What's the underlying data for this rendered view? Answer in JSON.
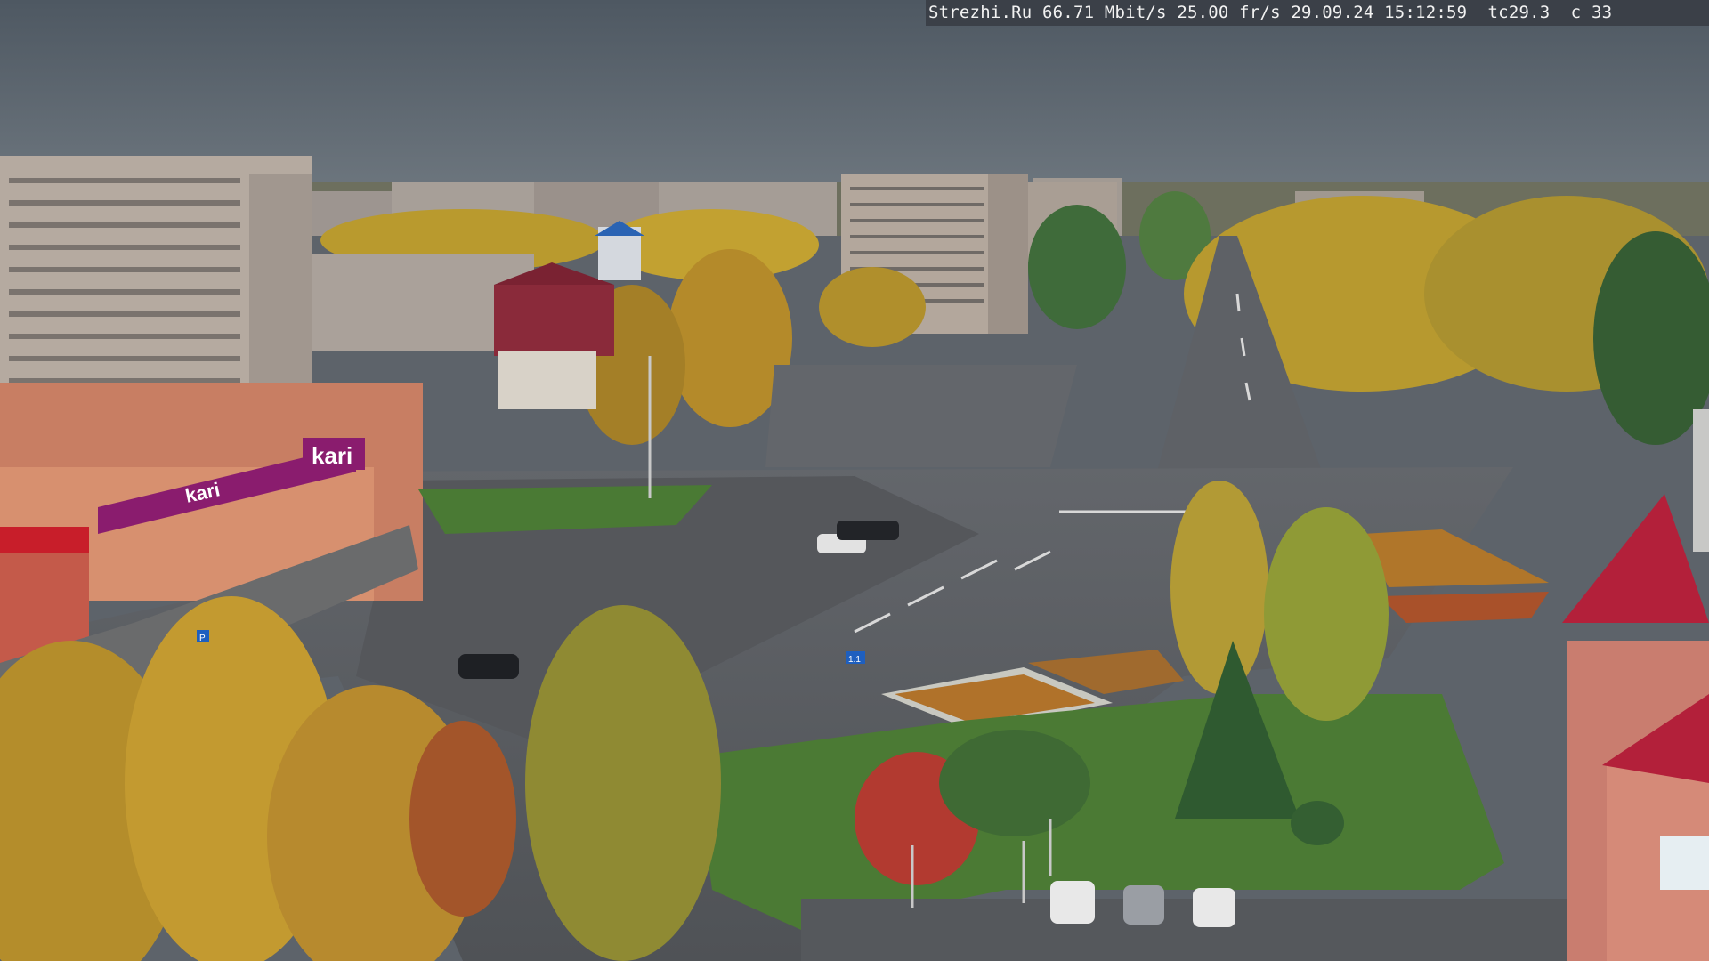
{
  "overlay": {
    "site": "Strezhi.Ru",
    "bitrate": "66.71 Mbit/s",
    "framerate": "25.00 fr/s",
    "date": "29.09.24",
    "time": "15:12:59",
    "temperature": "tc29.3",
    "counter": "c 33"
  },
  "signs": {
    "store_brand": "kari",
    "store_lower": "kari",
    "road_sign": "1.1",
    "pedestrian_sign": "P"
  },
  "colors": {
    "sky": "#5d6670",
    "asphalt": "#5a5c60",
    "grass": "#4b7a34",
    "autumn_foliage": "#b99a2e",
    "store_magenta": "#8a1c6e",
    "roof_red": "#b3203a"
  }
}
